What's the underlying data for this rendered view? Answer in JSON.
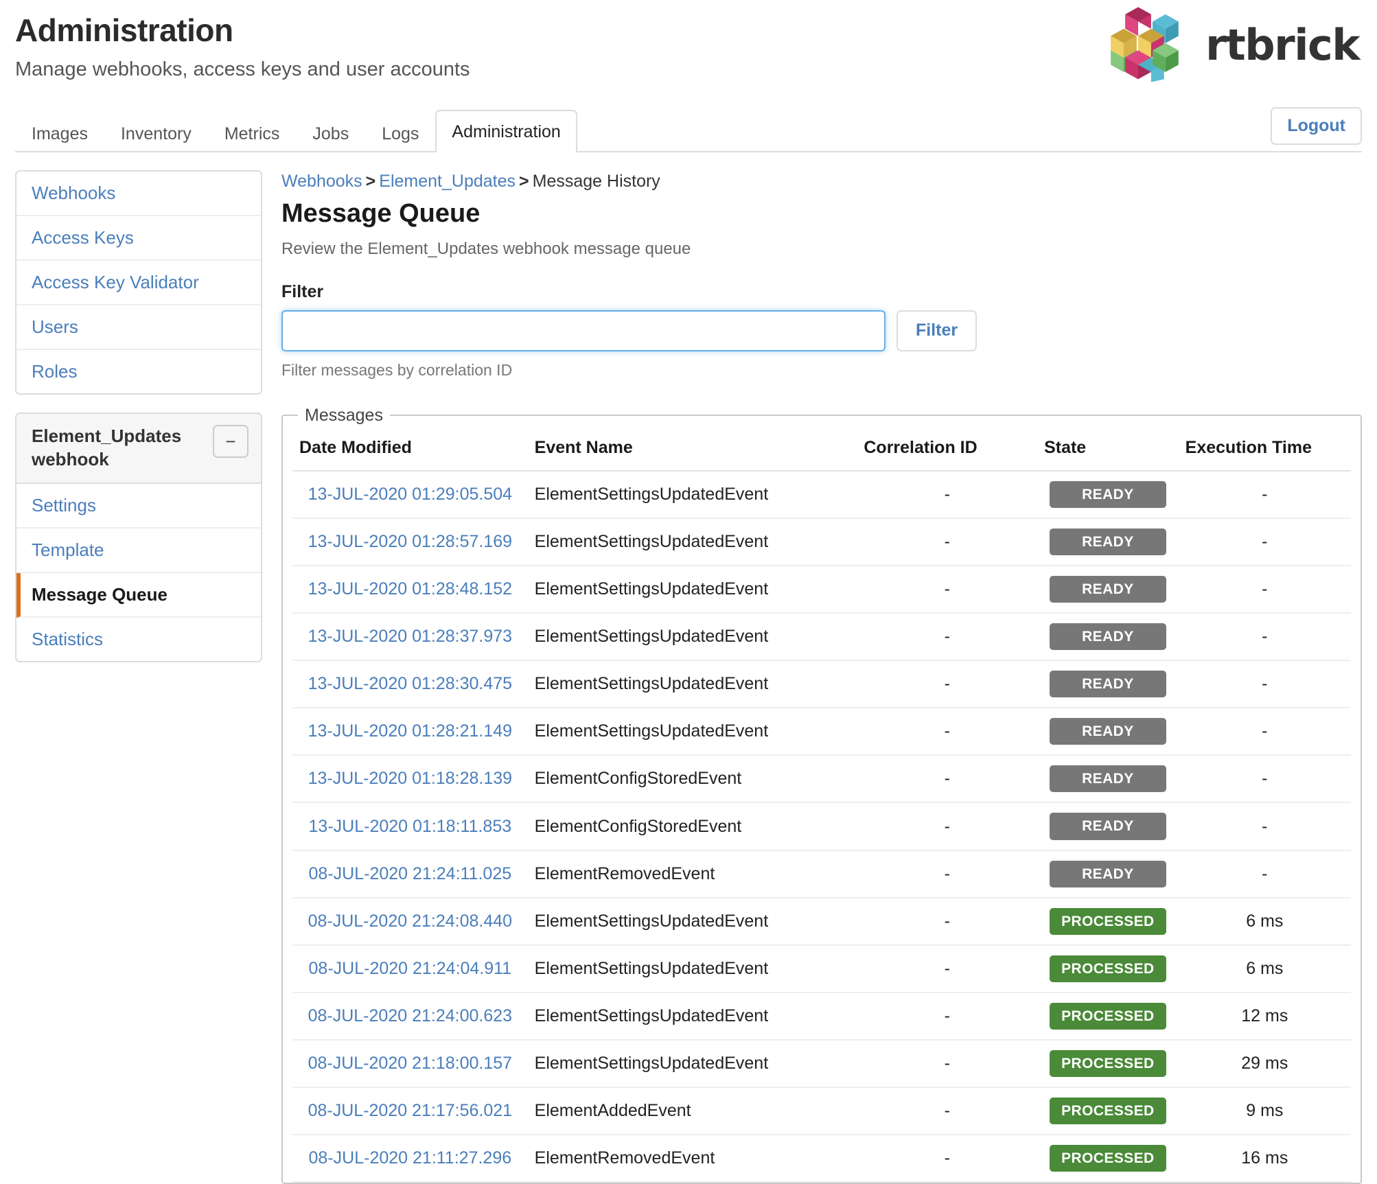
{
  "header": {
    "title": "Administration",
    "subtitle": "Manage webhooks, access keys and user accounts",
    "brand_name": "rtbrick",
    "brand_colors": {
      "magenta": "#c9336b",
      "pink": "#e0467f",
      "teal": "#4fb3c8",
      "cyan": "#5bbcd4",
      "gold": "#c9a33a",
      "yellow": "#f0cf63",
      "green": "#5fae5a",
      "light_green": "#86c87e",
      "dark_magenta": "#a82a59"
    }
  },
  "tabs": [
    {
      "label": "Images",
      "active": false
    },
    {
      "label": "Inventory",
      "active": false
    },
    {
      "label": "Metrics",
      "active": false
    },
    {
      "label": "Jobs",
      "active": false
    },
    {
      "label": "Logs",
      "active": false
    },
    {
      "label": "Administration",
      "active": true
    }
  ],
  "logout_label": "Logout",
  "sidebar": {
    "primary_items": [
      {
        "label": "Webhooks"
      },
      {
        "label": "Access Keys"
      },
      {
        "label": "Access Key Validator"
      },
      {
        "label": "Users"
      },
      {
        "label": "Roles"
      }
    ],
    "webhook_card": {
      "title": "Element_Updates webhook",
      "collapse_symbol": "−",
      "items": [
        {
          "label": "Settings",
          "active": false
        },
        {
          "label": "Template",
          "active": false
        },
        {
          "label": "Message Queue",
          "active": true
        },
        {
          "label": "Statistics",
          "active": false
        }
      ],
      "active_accent": "#d9721e"
    }
  },
  "breadcrumb": {
    "items": [
      {
        "label": "Webhooks",
        "link": true
      },
      {
        "label": "Element_Updates",
        "link": true
      },
      {
        "label": "Message History",
        "link": false
      }
    ],
    "separator": ">"
  },
  "main": {
    "title": "Message Queue",
    "description": "Review the Element_Updates webhook message queue",
    "filter": {
      "label": "Filter",
      "value": "",
      "placeholder": "",
      "button_label": "Filter",
      "hint": "Filter messages by correlation ID"
    },
    "messages": {
      "legend": "Messages",
      "columns": [
        "Date Modified",
        "Event Name",
        "Correlation ID",
        "State",
        "Execution Time"
      ],
      "state_colors": {
        "READY": "#777777",
        "PROCESSED": "#4a8a38"
      },
      "rows": [
        {
          "date": "13-JUL-2020 01:29:05.504",
          "event": "ElementSettingsUpdatedEvent",
          "correlation": "-",
          "state": "READY",
          "exec": "-"
        },
        {
          "date": "13-JUL-2020 01:28:57.169",
          "event": "ElementSettingsUpdatedEvent",
          "correlation": "-",
          "state": "READY",
          "exec": "-"
        },
        {
          "date": "13-JUL-2020 01:28:48.152",
          "event": "ElementSettingsUpdatedEvent",
          "correlation": "-",
          "state": "READY",
          "exec": "-"
        },
        {
          "date": "13-JUL-2020 01:28:37.973",
          "event": "ElementSettingsUpdatedEvent",
          "correlation": "-",
          "state": "READY",
          "exec": "-"
        },
        {
          "date": "13-JUL-2020 01:28:30.475",
          "event": "ElementSettingsUpdatedEvent",
          "correlation": "-",
          "state": "READY",
          "exec": "-"
        },
        {
          "date": "13-JUL-2020 01:28:21.149",
          "event": "ElementSettingsUpdatedEvent",
          "correlation": "-",
          "state": "READY",
          "exec": "-"
        },
        {
          "date": "13-JUL-2020 01:18:28.139",
          "event": "ElementConfigStoredEvent",
          "correlation": "-",
          "state": "READY",
          "exec": "-"
        },
        {
          "date": "13-JUL-2020 01:18:11.853",
          "event": "ElementConfigStoredEvent",
          "correlation": "-",
          "state": "READY",
          "exec": "-"
        },
        {
          "date": "08-JUL-2020 21:24:11.025",
          "event": "ElementRemovedEvent",
          "correlation": "-",
          "state": "READY",
          "exec": "-"
        },
        {
          "date": "08-JUL-2020 21:24:08.440",
          "event": "ElementSettingsUpdatedEvent",
          "correlation": "-",
          "state": "PROCESSED",
          "exec": "6 ms"
        },
        {
          "date": "08-JUL-2020 21:24:04.911",
          "event": "ElementSettingsUpdatedEvent",
          "correlation": "-",
          "state": "PROCESSED",
          "exec": "6 ms"
        },
        {
          "date": "08-JUL-2020 21:24:00.623",
          "event": "ElementSettingsUpdatedEvent",
          "correlation": "-",
          "state": "PROCESSED",
          "exec": "12 ms"
        },
        {
          "date": "08-JUL-2020 21:18:00.157",
          "event": "ElementSettingsUpdatedEvent",
          "correlation": "-",
          "state": "PROCESSED",
          "exec": "29 ms"
        },
        {
          "date": "08-JUL-2020 21:17:56.021",
          "event": "ElementAddedEvent",
          "correlation": "-",
          "state": "PROCESSED",
          "exec": "9 ms"
        },
        {
          "date": "08-JUL-2020 21:11:27.296",
          "event": "ElementRemovedEvent",
          "correlation": "-",
          "state": "PROCESSED",
          "exec": "16 ms"
        }
      ]
    }
  }
}
